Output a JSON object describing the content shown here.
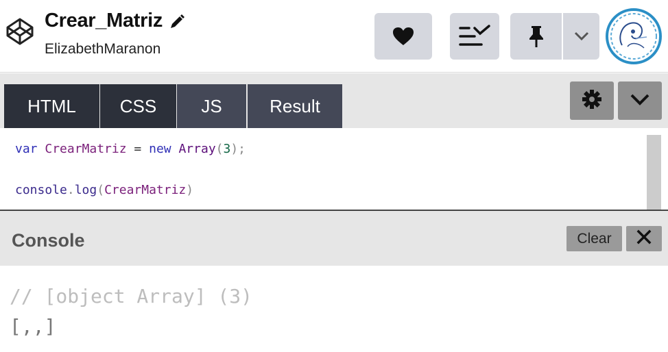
{
  "header": {
    "title": "Crear_Matriz",
    "author": "ElizabethMaranon",
    "icons": {
      "logo": "codepen-logo-icon",
      "edit": "pencil-icon",
      "love": "heart-icon",
      "collections": "add-to-collection-icon",
      "pin": "pin-icon",
      "pin_menu": "chevron-down-icon"
    }
  },
  "tabs": [
    {
      "label": "HTML"
    },
    {
      "label": "CSS"
    },
    {
      "label": "JS"
    },
    {
      "label": "Result"
    }
  ],
  "editor_controls": {
    "settings_icon": "gear-icon",
    "collapse_icon": "chevron-down-icon"
  },
  "code": {
    "line1": {
      "kw": "var",
      "ident": "CrearMatriz",
      "op": "=",
      "kw2": "new",
      "cls": "Array",
      "open": "(",
      "num": "3",
      "close": ");"
    },
    "line2": {
      "obj": "console",
      "dot": ".",
      "method": "log",
      "open": "(",
      "arg": "CrearMatriz",
      "close": ")"
    }
  },
  "console": {
    "title": "Console",
    "clear_label": "Clear",
    "close_icon": "close-icon",
    "output_comment": "// [object Array] (3)",
    "output_value": "[,,]"
  },
  "colors": {
    "tab_dark": "#2c303a",
    "tab_light": "#444857",
    "button_gray": "#d5d7de",
    "avatar_ring": "#2b8fc6"
  }
}
